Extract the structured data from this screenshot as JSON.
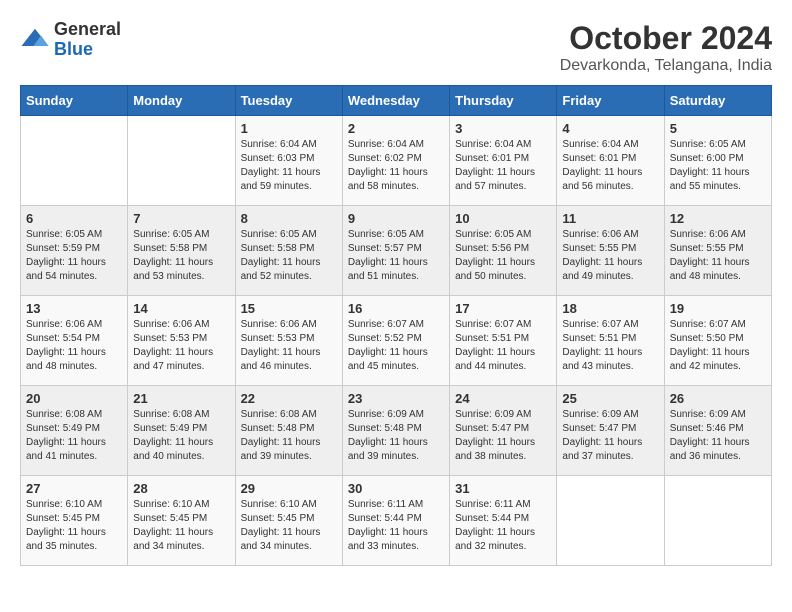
{
  "logo": {
    "general": "General",
    "blue": "Blue"
  },
  "title": "October 2024",
  "location": "Devarkonda, Telangana, India",
  "days_of_week": [
    "Sunday",
    "Monday",
    "Tuesday",
    "Wednesday",
    "Thursday",
    "Friday",
    "Saturday"
  ],
  "weeks": [
    [
      {
        "day": "",
        "info": ""
      },
      {
        "day": "",
        "info": ""
      },
      {
        "day": "1",
        "info": "Sunrise: 6:04 AM\nSunset: 6:03 PM\nDaylight: 11 hours and 59 minutes."
      },
      {
        "day": "2",
        "info": "Sunrise: 6:04 AM\nSunset: 6:02 PM\nDaylight: 11 hours and 58 minutes."
      },
      {
        "day": "3",
        "info": "Sunrise: 6:04 AM\nSunset: 6:01 PM\nDaylight: 11 hours and 57 minutes."
      },
      {
        "day": "4",
        "info": "Sunrise: 6:04 AM\nSunset: 6:01 PM\nDaylight: 11 hours and 56 minutes."
      },
      {
        "day": "5",
        "info": "Sunrise: 6:05 AM\nSunset: 6:00 PM\nDaylight: 11 hours and 55 minutes."
      }
    ],
    [
      {
        "day": "6",
        "info": "Sunrise: 6:05 AM\nSunset: 5:59 PM\nDaylight: 11 hours and 54 minutes."
      },
      {
        "day": "7",
        "info": "Sunrise: 6:05 AM\nSunset: 5:58 PM\nDaylight: 11 hours and 53 minutes."
      },
      {
        "day": "8",
        "info": "Sunrise: 6:05 AM\nSunset: 5:58 PM\nDaylight: 11 hours and 52 minutes."
      },
      {
        "day": "9",
        "info": "Sunrise: 6:05 AM\nSunset: 5:57 PM\nDaylight: 11 hours and 51 minutes."
      },
      {
        "day": "10",
        "info": "Sunrise: 6:05 AM\nSunset: 5:56 PM\nDaylight: 11 hours and 50 minutes."
      },
      {
        "day": "11",
        "info": "Sunrise: 6:06 AM\nSunset: 5:55 PM\nDaylight: 11 hours and 49 minutes."
      },
      {
        "day": "12",
        "info": "Sunrise: 6:06 AM\nSunset: 5:55 PM\nDaylight: 11 hours and 48 minutes."
      }
    ],
    [
      {
        "day": "13",
        "info": "Sunrise: 6:06 AM\nSunset: 5:54 PM\nDaylight: 11 hours and 48 minutes."
      },
      {
        "day": "14",
        "info": "Sunrise: 6:06 AM\nSunset: 5:53 PM\nDaylight: 11 hours and 47 minutes."
      },
      {
        "day": "15",
        "info": "Sunrise: 6:06 AM\nSunset: 5:53 PM\nDaylight: 11 hours and 46 minutes."
      },
      {
        "day": "16",
        "info": "Sunrise: 6:07 AM\nSunset: 5:52 PM\nDaylight: 11 hours and 45 minutes."
      },
      {
        "day": "17",
        "info": "Sunrise: 6:07 AM\nSunset: 5:51 PM\nDaylight: 11 hours and 44 minutes."
      },
      {
        "day": "18",
        "info": "Sunrise: 6:07 AM\nSunset: 5:51 PM\nDaylight: 11 hours and 43 minutes."
      },
      {
        "day": "19",
        "info": "Sunrise: 6:07 AM\nSunset: 5:50 PM\nDaylight: 11 hours and 42 minutes."
      }
    ],
    [
      {
        "day": "20",
        "info": "Sunrise: 6:08 AM\nSunset: 5:49 PM\nDaylight: 11 hours and 41 minutes."
      },
      {
        "day": "21",
        "info": "Sunrise: 6:08 AM\nSunset: 5:49 PM\nDaylight: 11 hours and 40 minutes."
      },
      {
        "day": "22",
        "info": "Sunrise: 6:08 AM\nSunset: 5:48 PM\nDaylight: 11 hours and 39 minutes."
      },
      {
        "day": "23",
        "info": "Sunrise: 6:09 AM\nSunset: 5:48 PM\nDaylight: 11 hours and 39 minutes."
      },
      {
        "day": "24",
        "info": "Sunrise: 6:09 AM\nSunset: 5:47 PM\nDaylight: 11 hours and 38 minutes."
      },
      {
        "day": "25",
        "info": "Sunrise: 6:09 AM\nSunset: 5:47 PM\nDaylight: 11 hours and 37 minutes."
      },
      {
        "day": "26",
        "info": "Sunrise: 6:09 AM\nSunset: 5:46 PM\nDaylight: 11 hours and 36 minutes."
      }
    ],
    [
      {
        "day": "27",
        "info": "Sunrise: 6:10 AM\nSunset: 5:45 PM\nDaylight: 11 hours and 35 minutes."
      },
      {
        "day": "28",
        "info": "Sunrise: 6:10 AM\nSunset: 5:45 PM\nDaylight: 11 hours and 34 minutes."
      },
      {
        "day": "29",
        "info": "Sunrise: 6:10 AM\nSunset: 5:45 PM\nDaylight: 11 hours and 34 minutes."
      },
      {
        "day": "30",
        "info": "Sunrise: 6:11 AM\nSunset: 5:44 PM\nDaylight: 11 hours and 33 minutes."
      },
      {
        "day": "31",
        "info": "Sunrise: 6:11 AM\nSunset: 5:44 PM\nDaylight: 11 hours and 32 minutes."
      },
      {
        "day": "",
        "info": ""
      },
      {
        "day": "",
        "info": ""
      }
    ]
  ]
}
